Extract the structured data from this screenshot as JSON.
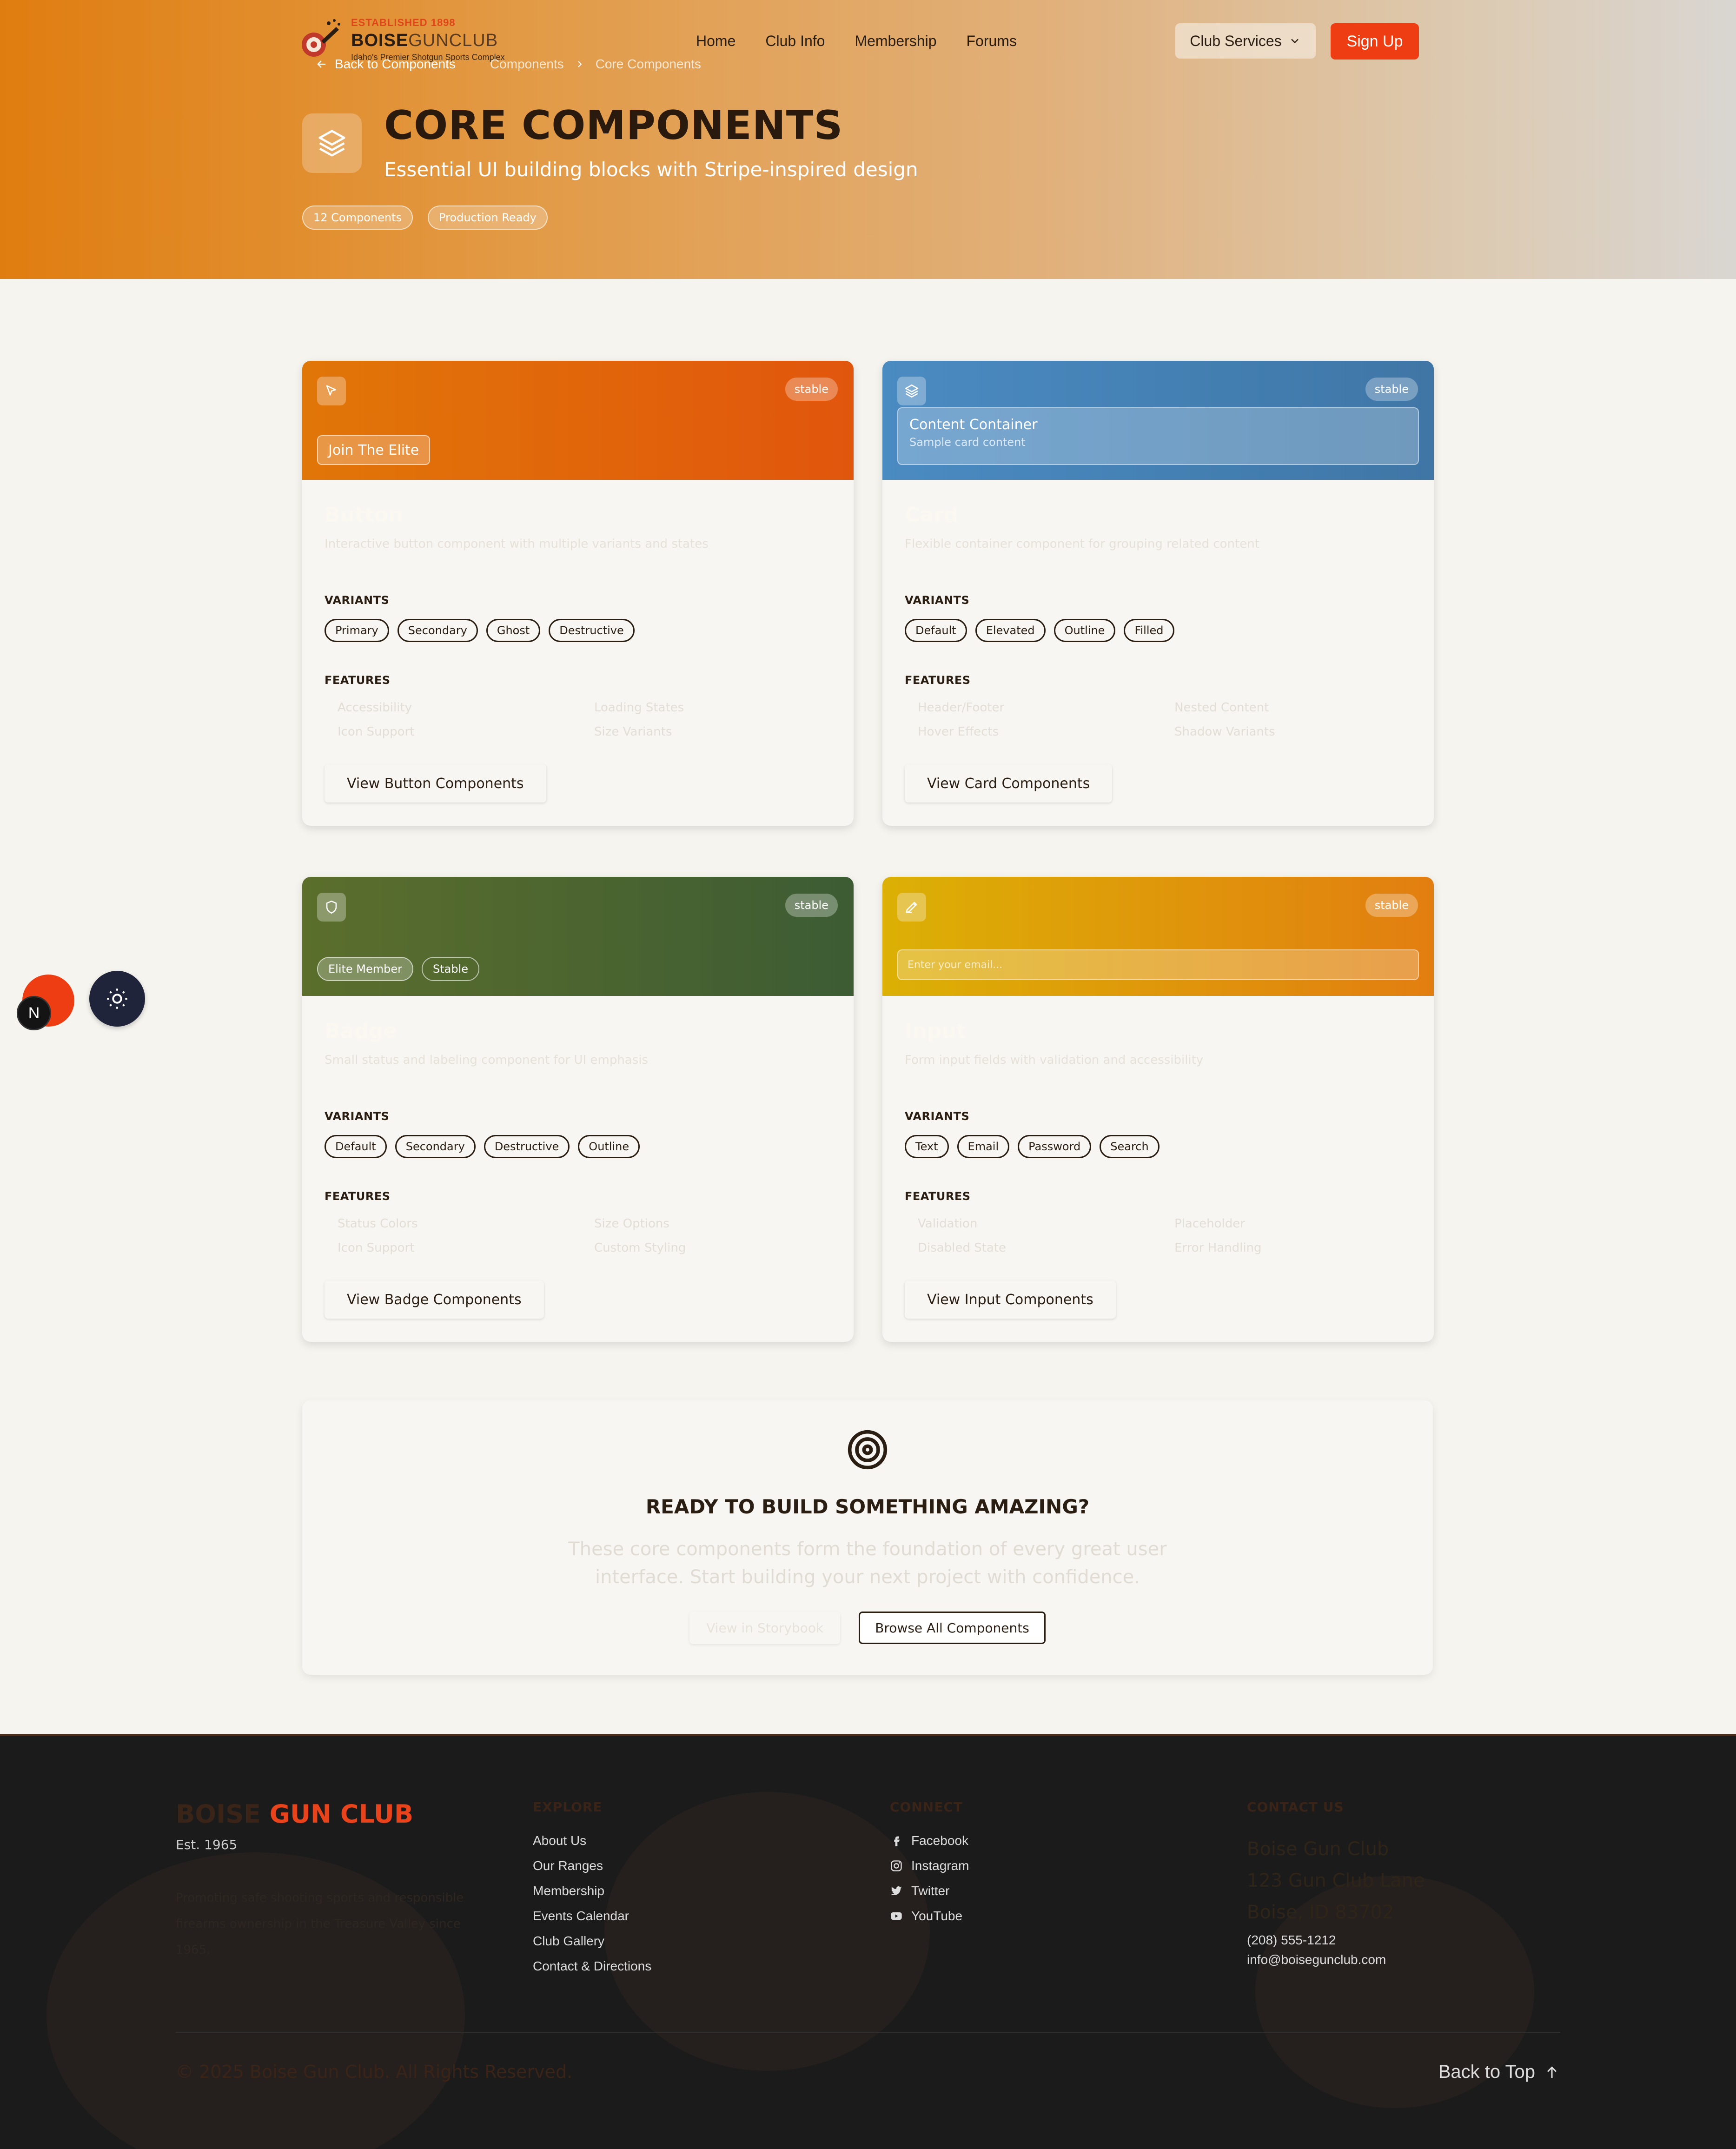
{
  "header": {
    "logo": {
      "established": "ESTABLISHED 1898",
      "name_bold": "BOISE",
      "name_light": "GUNCLUB",
      "tagline": "Idaho's Premier Shotgun Sports Complex"
    },
    "nav": [
      "Home",
      "Club Info",
      "Membership",
      "Forums"
    ],
    "club_services": "Club Services",
    "signup": "Sign Up",
    "breadcrumb": {
      "back": "Back to Components",
      "parent": "Components",
      "current": "Core Components"
    }
  },
  "hero": {
    "title": "CORE COMPONENTS",
    "subtitle": "Essential UI building blocks with Stripe-inspired design",
    "tags": [
      "12 Components",
      "Production Ready"
    ]
  },
  "labels": {
    "variants": "VARIANTS",
    "features": "FEATURES"
  },
  "cards": [
    {
      "status": "stable",
      "demo": "Join The Elite",
      "title": "Button",
      "description": "Interactive button component with multiple variants and states",
      "variants": [
        "Primary",
        "Secondary",
        "Ghost",
        "Destructive"
      ],
      "features": [
        "Accessibility",
        "Loading States",
        "Icon Support",
        "Size Variants"
      ],
      "cta": "View Button Components",
      "gradient": [
        "#e17608",
        "#e1560d"
      ]
    },
    {
      "status": "stable",
      "demo_title": "Content Container",
      "demo_sub": "Sample card content",
      "title": "Card",
      "description": "Flexible container component for grouping related content",
      "variants": [
        "Default",
        "Elevated",
        "Outline",
        "Filled"
      ],
      "features": [
        "Header/Footer",
        "Nested Content",
        "Hover Effects",
        "Shadow Variants"
      ],
      "cta": "View Card Components",
      "gradient": [
        "#4a8bc2",
        "#3f76a6"
      ]
    },
    {
      "status": "stable",
      "demo_badges": [
        "Elite Member",
        "Stable"
      ],
      "title": "Badge",
      "description": "Small status and labeling component for UI emphasis",
      "variants": [
        "Default",
        "Secondary",
        "Destructive",
        "Outline"
      ],
      "features": [
        "Status Colors",
        "Size Options",
        "Icon Support",
        "Custom Styling"
      ],
      "cta": "View Badge Components",
      "gradient": [
        "#5b6e2c",
        "#3d5c34"
      ]
    },
    {
      "status": "stable",
      "demo_placeholder": "Enter your email...",
      "title": "Input",
      "description": "Form input fields with validation and accessibility",
      "variants": [
        "Text",
        "Email",
        "Password",
        "Search"
      ],
      "features": [
        "Validation",
        "Placeholder",
        "Disabled State",
        "Error Handling"
      ],
      "cta": "View Input Components",
      "gradient": [
        "#dcb005",
        "#e27e10"
      ]
    }
  ],
  "cta": {
    "title": "READY TO BUILD SOMETHING AMAZING?",
    "text": "These core components form the foundation of every great user interface. Start building your next project with confidence.",
    "storybook": "View in Storybook",
    "browse": "Browse All Components"
  },
  "floating": {
    "n_badge": "N"
  },
  "footer": {
    "brand_a": "BOISE",
    "brand_b": "GUN CLUB",
    "est": "Est. 1965",
    "description": "Promoting safe shooting sports and responsible firearms ownership in the Treasure Valley since 1965.",
    "explore": {
      "heading": "EXPLORE",
      "links": [
        "About Us",
        "Our Ranges",
        "Membership",
        "Events Calendar",
        "Club Gallery",
        "Contact & Directions"
      ]
    },
    "connect": {
      "heading": "CONNECT",
      "links": [
        "Facebook",
        "Instagram",
        "Twitter",
        "YouTube"
      ]
    },
    "contact": {
      "heading": "CONTACT US",
      "name": "Boise Gun Club",
      "street": "123 Gun Club Lane",
      "city": "Boise, ID 83702",
      "phone": "(208) 555-1212",
      "email": "info@boisegunclub.com"
    },
    "copyright": "© 2025 Boise Gun Club. All Rights Reserved.",
    "back_to_top": "Back to Top"
  },
  "colors": {
    "accent": "#ee3d12",
    "dark": "#2a1d12",
    "footer_bg": "#1b1b1b"
  }
}
